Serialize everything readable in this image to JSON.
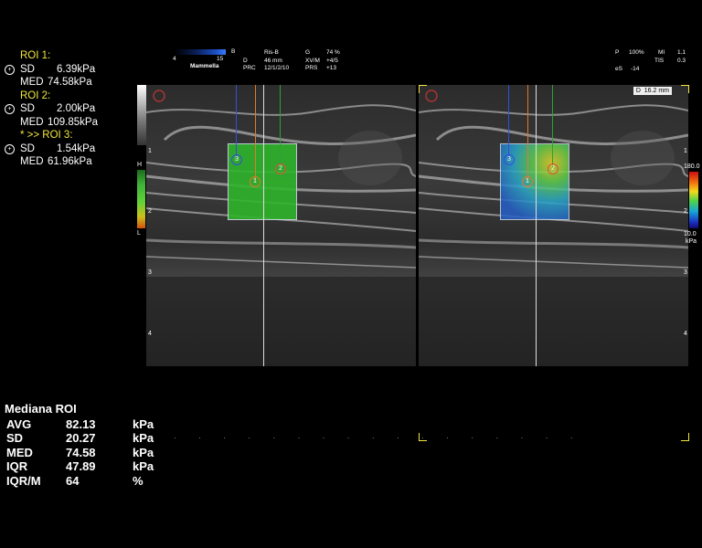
{
  "roi_panel": {
    "rois": [
      {
        "title": "ROI 1:",
        "sd_label": "SD",
        "sd_value": "6.39kPa",
        "med_label": "MED",
        "med_value": "74.58kPa"
      },
      {
        "title": "ROI 2:",
        "sd_label": "SD",
        "sd_value": "2.00kPa",
        "med_label": "MED",
        "med_value": "109.85kPa"
      },
      {
        "title": "* >> ROI 3:",
        "sd_label": "SD",
        "sd_value": "1.54kPa",
        "med_label": "MED",
        "med_value": "61.96kPa"
      }
    ]
  },
  "header": {
    "colorbar_min": "4",
    "colorbar_max": "15",
    "colorbar_unit": "B",
    "preset": "Mammella",
    "col1": [
      {
        "label": "",
        "value": "Ris-B"
      },
      {
        "label": "D",
        "value": "46 mm"
      },
      {
        "label": "PRC",
        "value": "12/1/2/10"
      }
    ],
    "col2": [
      {
        "label": "G",
        "value": "74 %"
      },
      {
        "label": "XV/M",
        "value": "+4/5"
      },
      {
        "label": "PRS",
        "value": "+13"
      }
    ],
    "right": [
      {
        "label": "P",
        "value": "100%"
      },
      {
        "label": "MI",
        "value": "1.1"
      },
      {
        "label": "TIS",
        "value": "0.3"
      },
      {
        "label": "eS",
        "value": "-14"
      }
    ],
    "distance_label": "D",
    "distance_value": "16.2 mm"
  },
  "depth_ticks": [
    "1",
    "2",
    "3",
    "4"
  ],
  "elasticity_scale": {
    "top": "H",
    "bottom": "L"
  },
  "kpa_scale": {
    "max": "180.0",
    "min": "10.0",
    "unit": "kPa"
  },
  "roi_markers": [
    "1",
    "2",
    "3"
  ],
  "stats": {
    "title": "Mediana ROI",
    "rows": [
      {
        "label": "AVG",
        "value": "82.13",
        "unit": "kPa"
      },
      {
        "label": "SD",
        "value": "20.27",
        "unit": "kPa"
      },
      {
        "label": "MED",
        "value": "74.58",
        "unit": "kPa"
      },
      {
        "label": "IQR",
        "value": "47.89",
        "unit": "kPa"
      },
      {
        "label": "IQR/M",
        "value": "64",
        "unit": "%"
      }
    ]
  },
  "colors": {
    "accent_yellow": "#f2e640",
    "roi1": "#e07a2a",
    "roi2": "#2fa036",
    "roi3": "#2548c8"
  }
}
